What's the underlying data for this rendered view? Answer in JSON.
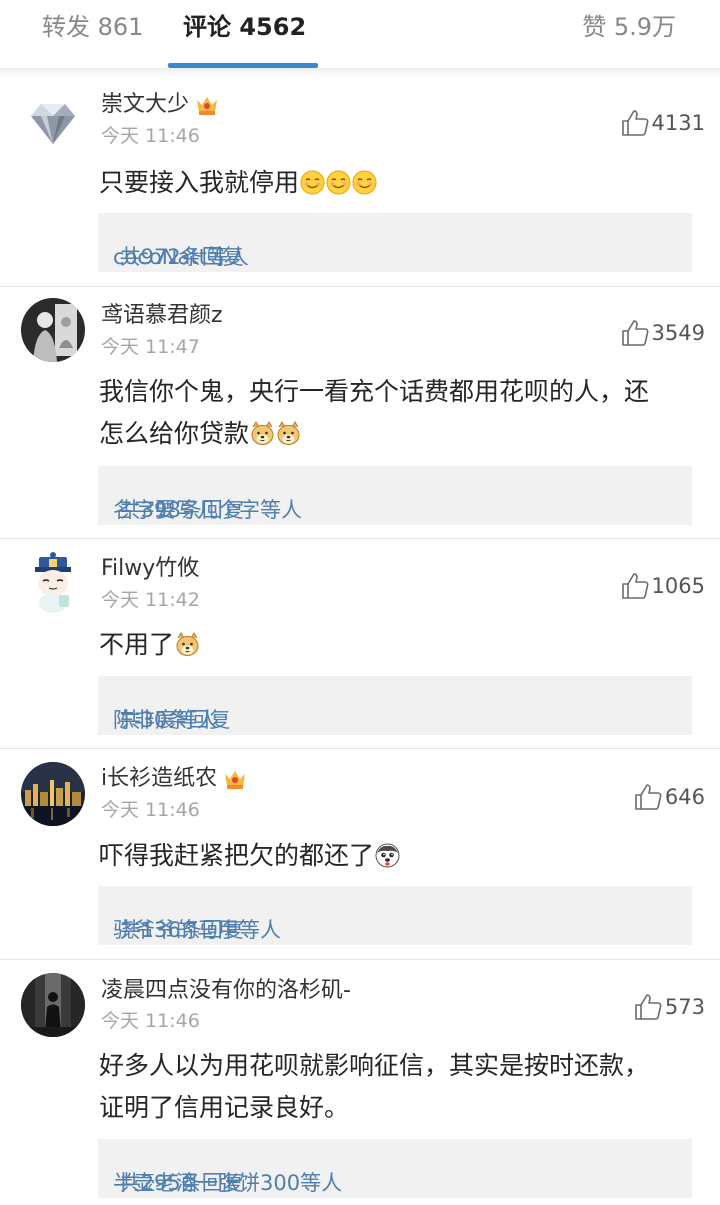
{
  "tabs": {
    "repost": "转发 861",
    "comment": "评论 4562",
    "like": "赞 5.9万"
  },
  "colors": {
    "accent": "#3b87cf",
    "link": "#4f7fb0",
    "reply_bg": "#f1f1f1"
  },
  "comments": [
    {
      "username": "崇文大少",
      "vip_crown": true,
      "avatar_icon": "diamond-avatar",
      "time": "今天 11:46",
      "likes": "4131",
      "text_lines": [
        "只要接入我就停用"
      ],
      "emoji": [
        "smile-emoji",
        "smile-emoji",
        "smile-emoji"
      ],
      "reply_users": "cocoNatt等人",
      "reply_count": "共972条回复"
    },
    {
      "username": "鸢语慕君颜z",
      "vip_crown": false,
      "avatar_icon": "portrait-avatar",
      "time": "今天 11:47",
      "likes": "3549",
      "text_lines": [
        "我信你个鬼，央行一看充个话费都用花呗的人，还",
        "怎么给你贷款"
      ],
      "emoji": [
        "doge-emoji",
        "doge-emoji"
      ],
      "reply_users": "名字要写几个字等人",
      "reply_count": "共398条回复"
    },
    {
      "username": "Filwy竹攸",
      "vip_crown": false,
      "avatar_icon": "cartoon-avatar",
      "time": "今天 11:42",
      "likes": "1065",
      "text_lines": [
        "不用了"
      ],
      "emoji": [
        "doge-emoji"
      ],
      "reply_users": "陈非宸等人",
      "reply_count": "共30条回复"
    },
    {
      "username": "i长衫造纸农",
      "vip_crown": true,
      "avatar_icon": "city-night-avatar",
      "time": "今天 11:46",
      "likes": "646",
      "text_lines": [
        "吓得我赶紧把欠的都还了"
      ],
      "emoji": [
        "husky-emoji"
      ],
      "reply_users": "骁爷爷的马甲等人",
      "reply_count": "共136条回复"
    },
    {
      "username": "凌晨四点没有你的洛杉矶-",
      "vip_crown": false,
      "avatar_icon": "silhouette-avatar",
      "time": "今天 11:46",
      "likes": "573",
      "text_lines": [
        "好多人以为用花呗就影响征信，其实是按时还款，",
        "证明了信用记录良好。"
      ],
      "emoji": [],
      "reply_users": "半壶老酒一张饼300等人",
      "reply_count": "共295条回复"
    }
  ]
}
